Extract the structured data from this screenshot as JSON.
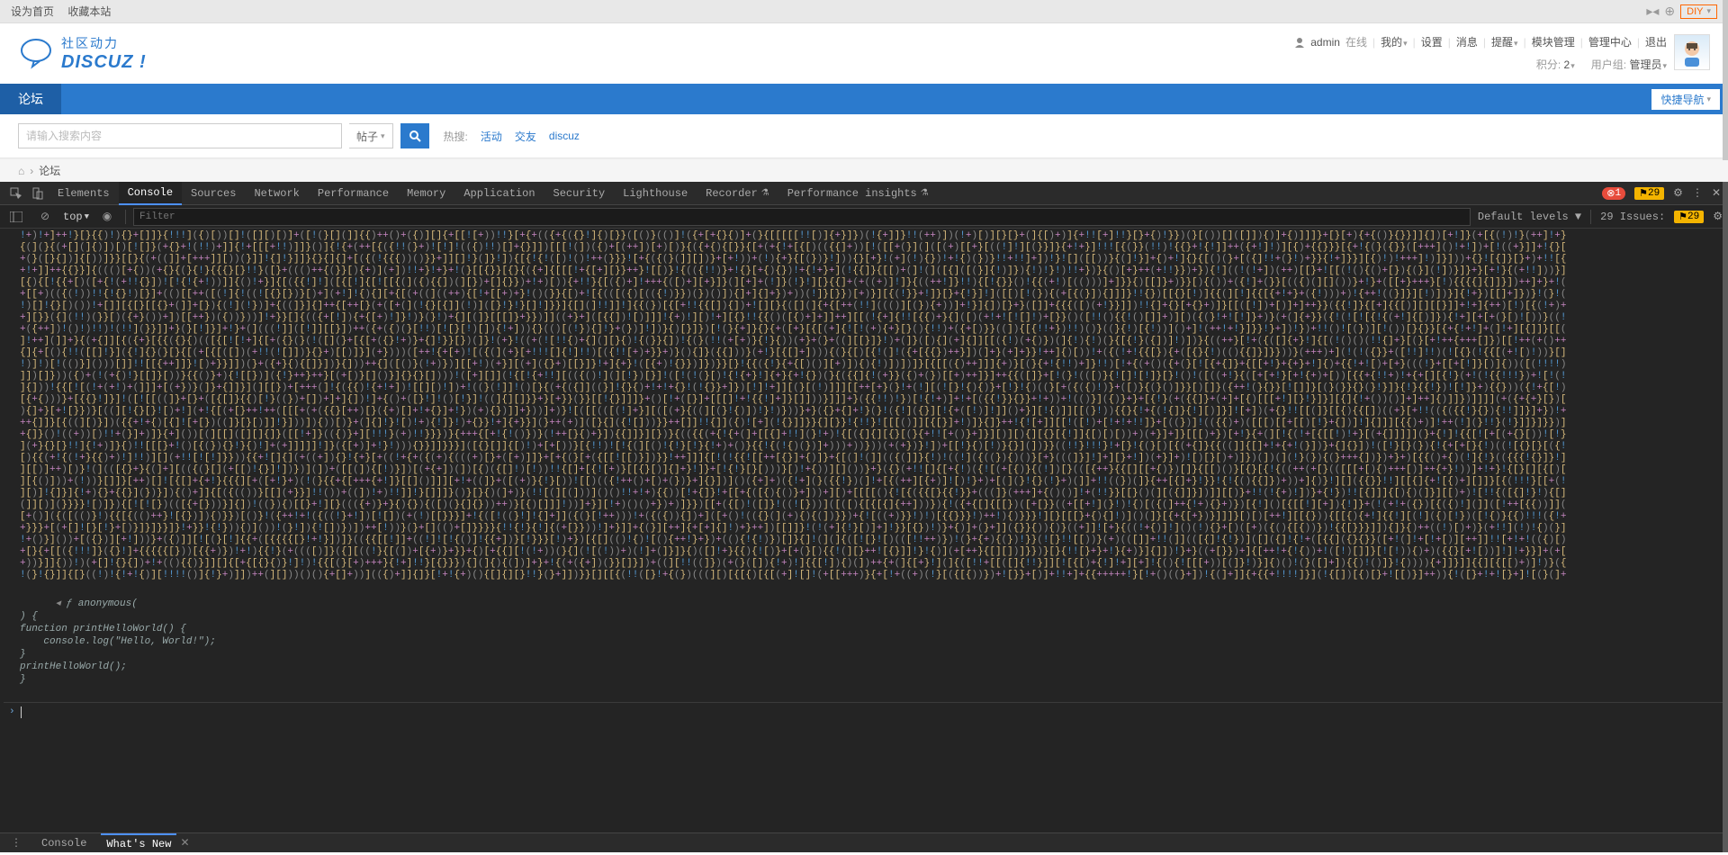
{
  "topbar": {
    "home": "设为首页",
    "fav": "收藏本站",
    "diy": "DIY"
  },
  "logo": {
    "cn": "社区动力",
    "en": "DISCUZ !"
  },
  "user": {
    "name": "admin",
    "status": "在线",
    "links": {
      "mine": "我的",
      "settings": "设置",
      "msg": "消息",
      "remind": "提醒",
      "module": "模块管理",
      "center": "管理中心",
      "logout": "退出"
    },
    "row2": {
      "points_lbl": "积分:",
      "points_val": "2",
      "group_lbl": "用户组:",
      "group_val": "管理员"
    }
  },
  "nav": {
    "forum": "论坛",
    "quick": "快捷导航"
  },
  "search": {
    "placeholder": "请输入搜索内容",
    "type": "帖子",
    "hot_lbl": "热搜:",
    "hot": [
      "活动",
      "交友",
      "discuz"
    ]
  },
  "breadcrumb": {
    "item": "论坛"
  },
  "devtools": {
    "tabs": [
      "Elements",
      "Console",
      "Sources",
      "Network",
      "Performance",
      "Memory",
      "Application",
      "Security",
      "Lighthouse",
      "Recorder",
      "Performance insights"
    ],
    "active_tab": "Console",
    "errors": "1",
    "warnings": "29",
    "bar2": {
      "context": "top",
      "filter_ph": "Filter",
      "levels": "Default levels",
      "issues_lbl": "29 Issues:",
      "issues_warn": "29"
    },
    "func_lines": [
      "ƒ anonymous(",
      ") {",
      "function printHelloWorld() {",
      "    console.log(\"Hello, World!\");",
      "}",
      "printHelloWorld();",
      "}"
    ],
    "bottom": {
      "console": "Console",
      "whatsnew": "What's New"
    }
  }
}
